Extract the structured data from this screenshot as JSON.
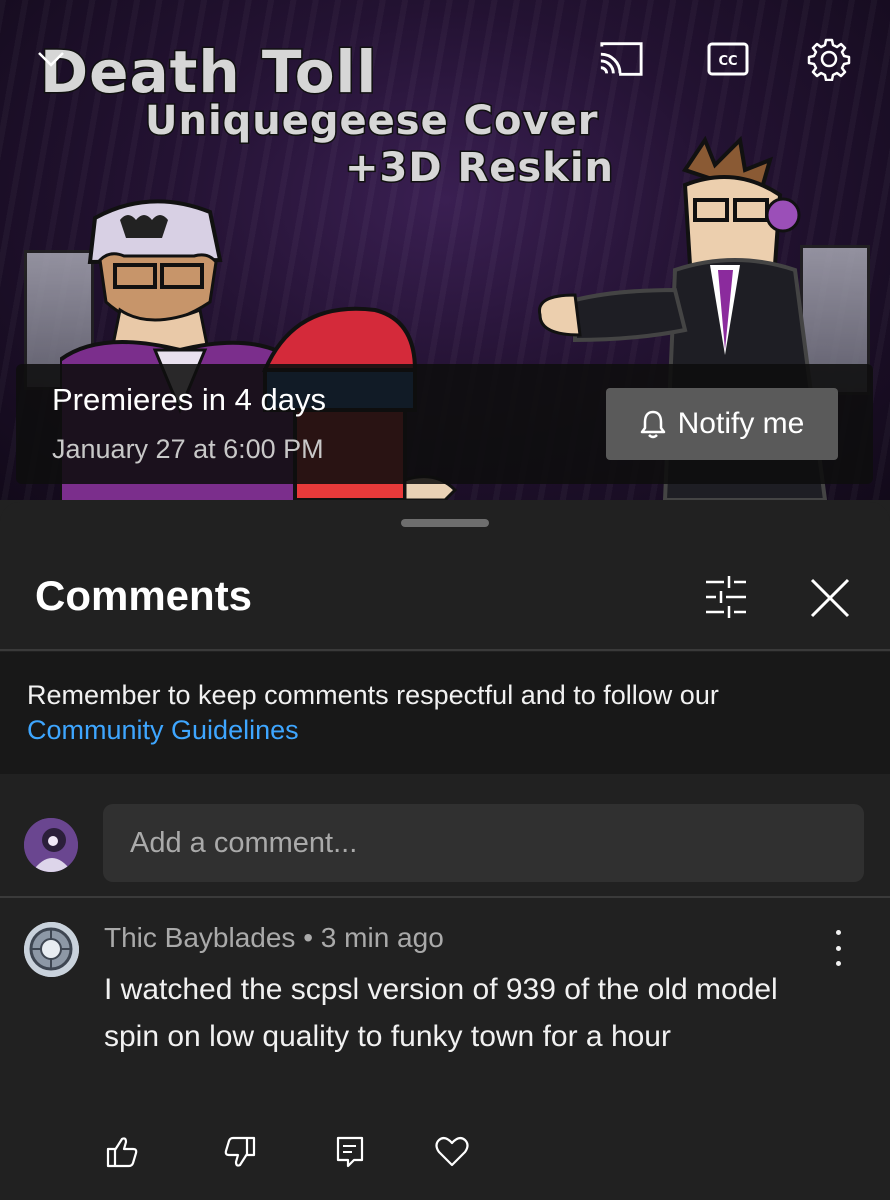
{
  "video": {
    "title_line1": "Death Toll",
    "title_line2": "Uniquegeese Cover",
    "title_line3": "+3D Reskin",
    "icons": [
      "chevron-down-icon",
      "cast-icon",
      "cc-icon",
      "gear-icon"
    ]
  },
  "premiere": {
    "status": "Premieres in 4 days",
    "date": "January 27 at 6:00 PM",
    "notify_label": "Notify me",
    "notify_icon": "bell-icon"
  },
  "comments": {
    "title": "Comments",
    "notice_text": "Remember to keep comments respectful and to follow our",
    "guidelines_link": "Community Guidelines",
    "link_color": "#3ea6ff",
    "add_placeholder": "Add a comment...",
    "items": [
      {
        "author": "Thic Bayblades",
        "time": "3 min ago",
        "meta": "Thic Bayblades • 3 min ago",
        "text": "I watched the scpsl version of 939 of the old model spin on low quality to funky town for a hour"
      }
    ],
    "action_icons": [
      "thumbs-up-icon",
      "thumbs-down-icon",
      "reply-icon",
      "heart-icon"
    ]
  }
}
